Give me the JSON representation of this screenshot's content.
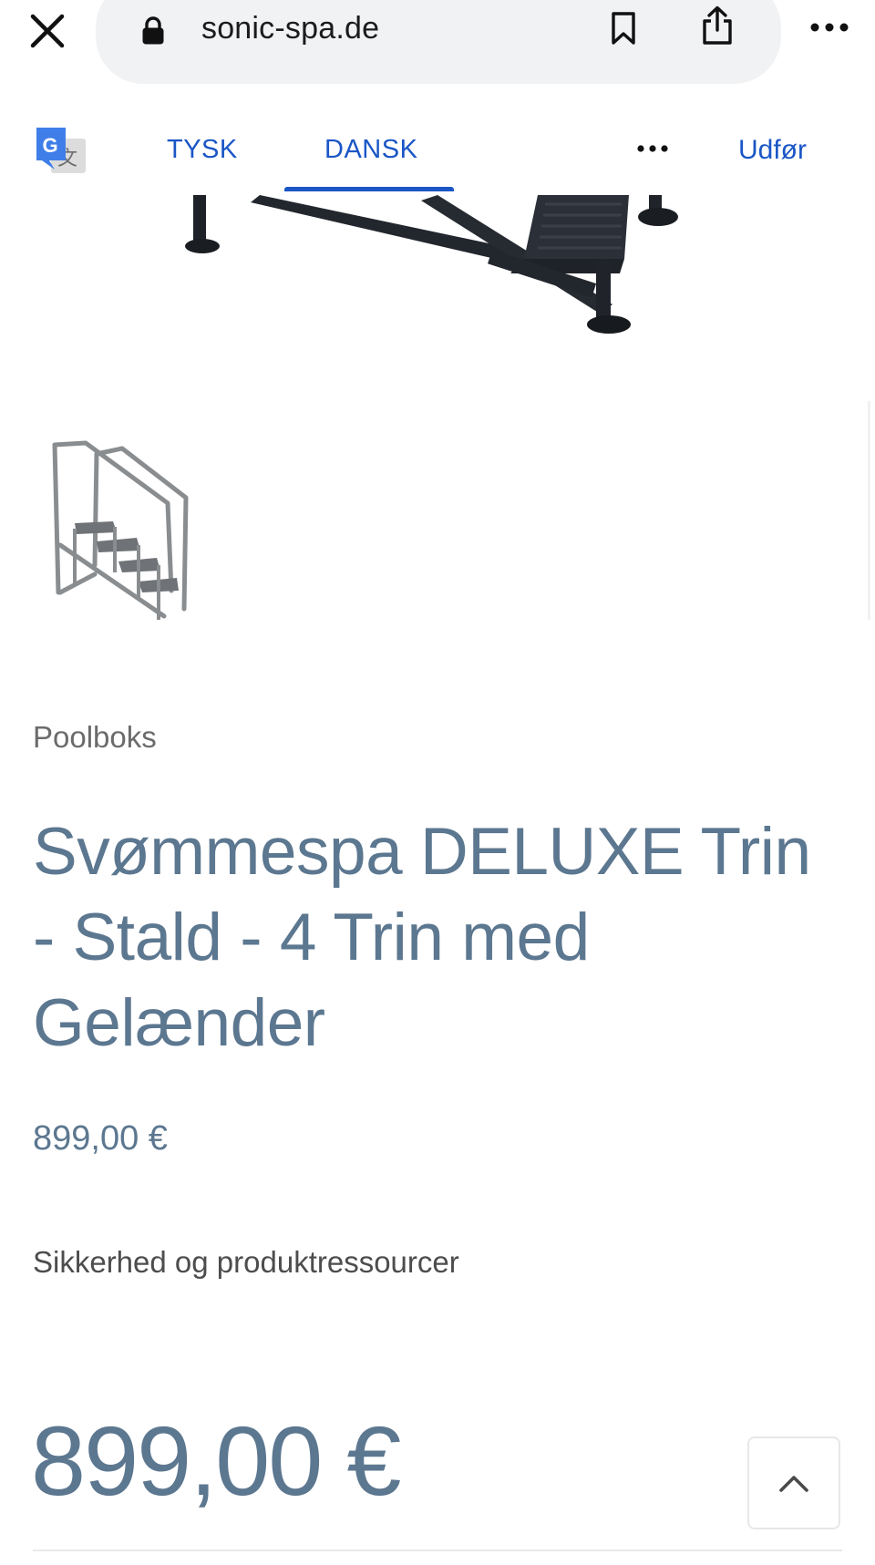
{
  "browser": {
    "url": "sonic-spa.de",
    "icons": [
      "close-icon",
      "lock-icon",
      "bookmark-icon",
      "share-icon",
      "more-horizontal-icon"
    ]
  },
  "translate_bar": {
    "tabs": [
      {
        "label": "TYSK",
        "selected": false
      },
      {
        "label": "DANSK",
        "selected": true
      }
    ],
    "done_label": "Udfør",
    "accent_color": "#1a56c6"
  },
  "product": {
    "category": "Poolboks",
    "title": "Svømmespa DELUXE Trin - Stald - 4 Trin med Gelænder",
    "price": "899,00 €",
    "resources_link": "Sikkerhed og produktressourcer",
    "sticky_price": "899,00 €",
    "text_color": "#5c7790"
  }
}
